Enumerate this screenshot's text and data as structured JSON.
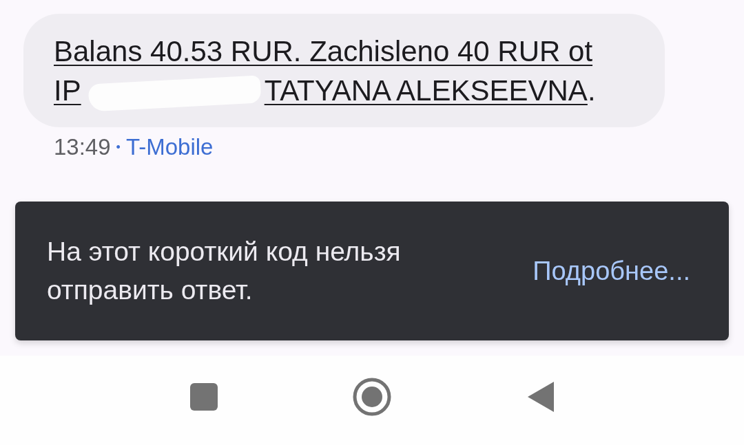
{
  "message": {
    "line_1": "Balans 40.53 RUR. Zachisleno 40 RUR ot",
    "line_2_start": "IP",
    "redacted": true,
    "line_2_end": "TATYANA ALEKSEEVNA",
    "line_2_tail": "."
  },
  "meta": {
    "time": "13:49",
    "separator": "•",
    "sender": "T-Mobile"
  },
  "snackbar": {
    "text": "На этот короткий код нельзя отправить ответ.",
    "action": "Подробнее..."
  },
  "nav_bar": [
    {
      "kind": "recents"
    },
    {
      "kind": "home"
    },
    {
      "kind": "back"
    }
  ]
}
